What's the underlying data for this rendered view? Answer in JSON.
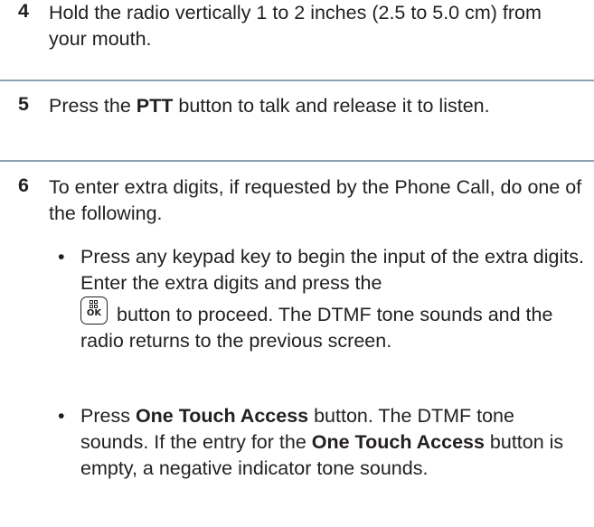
{
  "steps": [
    {
      "number": "4",
      "text": "Hold the radio vertically 1 to 2 inches (2.5 to 5.0 cm) from your mouth."
    },
    {
      "number": "5",
      "text_pre": "Press the ",
      "text_bold": "PTT",
      "text_post": " button to talk and release it to listen."
    },
    {
      "number": "6",
      "text": "To enter extra digits, if requested by the Phone Call, do one of the following."
    }
  ],
  "bullets": [
    {
      "marker": "•",
      "text_pre": "Press any keypad key to begin the input of the extra digits. Enter the extra digits and press the",
      "icon": "menu-ok-button-icon",
      "icon_label": "OK",
      "text_post": "button to proceed. The DTMF tone sounds and the radio returns to the previous screen."
    },
    {
      "marker": "•",
      "text_1": "Press ",
      "bold_1": "One Touch Access",
      "text_2": " button. The DTMF tone sounds. If the entry for the ",
      "bold_2": "One Touch Access",
      "text_3": " button is empty, a negative indicator tone sounds."
    }
  ],
  "colors": {
    "text": "#231f20",
    "rule": "#8da3b3"
  }
}
